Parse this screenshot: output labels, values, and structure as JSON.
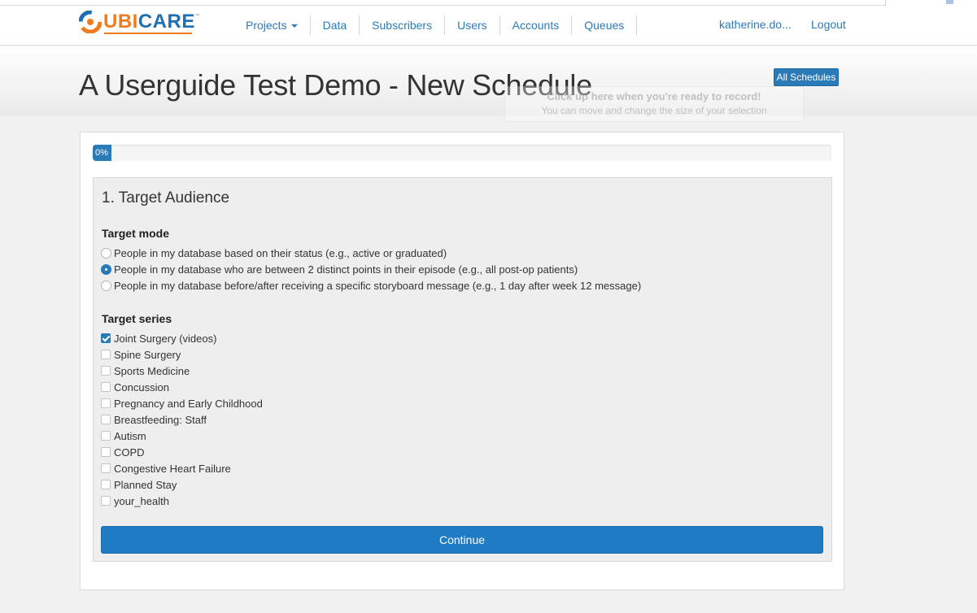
{
  "brand": {
    "logo_left": "UBI",
    "logo_right": "CARE",
    "logo_tm": "™"
  },
  "nav": {
    "items": [
      {
        "label": "Projects",
        "has_caret": true
      },
      {
        "label": "Data"
      },
      {
        "label": "Subscribers"
      },
      {
        "label": "Users"
      },
      {
        "label": "Accounts"
      },
      {
        "label": "Queues"
      }
    ],
    "user": "katherine.do...",
    "logout": "Logout"
  },
  "header": {
    "title": "A Userguide Test Demo - New Schedule",
    "all_schedules_button": "All Schedules"
  },
  "record_overlay": {
    "line1": "Click up here when you're ready to record!",
    "line2": "You can move and change the size of your selection"
  },
  "progress": {
    "label": "0%",
    "value_percent": 0
  },
  "step": {
    "title": "1. Target Audience",
    "target_mode": {
      "label": "Target mode",
      "options": [
        {
          "label": "People in my database based on their status (e.g., active or graduated)",
          "checked": false
        },
        {
          "label": "People in my database who are between 2 distinct points in their episode (e.g., all post-op patients)",
          "checked": true
        },
        {
          "label": "People in my database before/after receiving a specific storyboard message (e.g., 1 day after week 12 message)",
          "checked": false
        }
      ]
    },
    "target_series": {
      "label": "Target series",
      "options": [
        {
          "label": "Joint Surgery (videos)",
          "checked": true
        },
        {
          "label": "Spine Surgery",
          "checked": false
        },
        {
          "label": "Sports Medicine",
          "checked": false
        },
        {
          "label": "Concussion",
          "checked": false
        },
        {
          "label": "Pregnancy and Early Childhood",
          "checked": false
        },
        {
          "label": "Breastfeeding: Staff",
          "checked": false
        },
        {
          "label": "Autism",
          "checked": false
        },
        {
          "label": "COPD",
          "checked": false
        },
        {
          "label": "Congestive Heart Failure",
          "checked": false
        },
        {
          "label": "Planned Stay",
          "checked": false
        },
        {
          "label": "your_health",
          "checked": false
        }
      ]
    },
    "continue_button": "Continue"
  },
  "colors": {
    "primary": "#2a7ab8",
    "brand_orange": "#f07c1e",
    "brand_blue": "#1f6fb3"
  }
}
